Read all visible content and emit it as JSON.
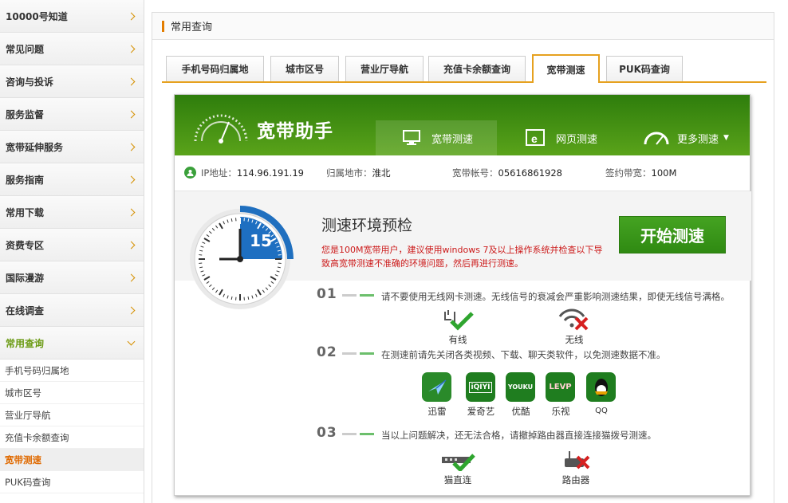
{
  "sidebar": {
    "items": [
      {
        "label": "10000号知道"
      },
      {
        "label": "常见问题"
      },
      {
        "label": "咨询与投诉"
      },
      {
        "label": "服务监督"
      },
      {
        "label": "宽带延伸服务"
      },
      {
        "label": "服务指南"
      },
      {
        "label": "常用下载"
      },
      {
        "label": "资费专区"
      },
      {
        "label": "国际漫游"
      },
      {
        "label": "在线调查"
      },
      {
        "label": "常用查询"
      }
    ],
    "subitems": [
      {
        "label": "手机号码归属地"
      },
      {
        "label": "城市区号"
      },
      {
        "label": "营业厅导航"
      },
      {
        "label": "充值卡余额查询"
      },
      {
        "label": "宽带测速"
      },
      {
        "label": "PUK码查询"
      }
    ]
  },
  "main": {
    "title": "常用查询",
    "tabs": [
      {
        "label": "手机号码归属地"
      },
      {
        "label": "城市区号"
      },
      {
        "label": "营业厅导航"
      },
      {
        "label": "充值卡余额查询"
      },
      {
        "label": "宽带测速"
      },
      {
        "label": "PUK码查询"
      }
    ]
  },
  "banner": {
    "brand": "宽带助手",
    "tabs": {
      "speed": "宽带测速",
      "web": "网页测速",
      "more": "更多测速"
    }
  },
  "info": {
    "ip_label": "IP地址：",
    "ip_value": "114.96.191.19",
    "city_label": "归属地市：",
    "city_value": "淮北",
    "account_label": "宽带帐号：",
    "account_value": "05616861928",
    "bandwidth_label": "签约带宽：",
    "bandwidth_value": "100M"
  },
  "test": {
    "timer_value": "15",
    "title": "测速环境预检",
    "warning": "您是100M宽带用户，建议使用windows 7及以上操作系统并检查以下导致高宽带测速不准确的环境问题，然后再进行测速。",
    "start_button": "开始测速"
  },
  "steps": [
    {
      "num": "01",
      "text": "请不要使用无线网卡测速。无线信号的衰减会严重影响测速结果，即使无线信号满格。"
    },
    {
      "num": "02",
      "text": "在测速前请先关闭各类视频、下载、聊天类软件，以免测速数据不准。"
    },
    {
      "num": "03",
      "text": "当以上问题解决，还无法合格，请撤掉路由器直接连接猫拨号测速。"
    }
  ],
  "step1_options": {
    "wired": "有线",
    "wireless": "无线"
  },
  "apps": [
    {
      "name": "迅雷",
      "icon": "xunlei-icon",
      "color": "#2a8a2a"
    },
    {
      "name": "爱奇艺",
      "icon": "iqiyi-icon",
      "color": "#1f7d1f"
    },
    {
      "name": "优酷",
      "icon": "youku-icon",
      "color": "#1f7d1f"
    },
    {
      "name": "乐视",
      "icon": "letv-icon",
      "color": "#1f7d1f"
    },
    {
      "name": "QQ",
      "icon": "qq-icon",
      "color": "#1f7d1f"
    }
  ],
  "app_badges": {
    "iqiyi": "iQIYI",
    "youku": "YOUKU",
    "letv": "LEVP"
  },
  "step3_options": {
    "modem": "猫直连",
    "router": "路由器"
  }
}
